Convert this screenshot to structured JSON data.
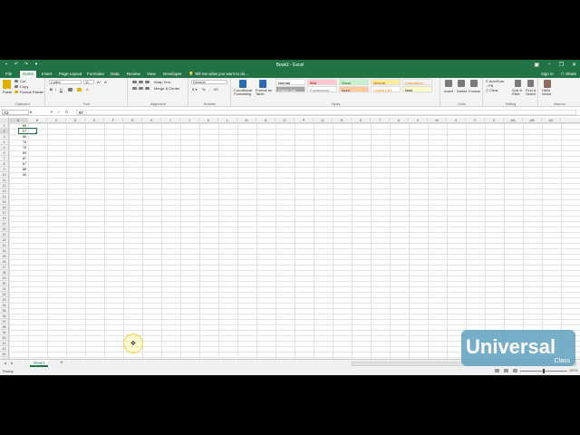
{
  "titlebar": {
    "title": "Book2 - Excel",
    "min": "−",
    "restore": "❐",
    "close": "✕"
  },
  "tabs": [
    {
      "label": "File"
    },
    {
      "label": "Home"
    },
    {
      "label": "Insert"
    },
    {
      "label": "Page Layout"
    },
    {
      "label": "Formulas"
    },
    {
      "label": "Data"
    },
    {
      "label": "Review"
    },
    {
      "label": "View"
    },
    {
      "label": "Developer"
    }
  ],
  "tell_me": "Tell me what you want to do...",
  "signin": "Sign in",
  "share": "Share",
  "ribbon": {
    "clipboard": {
      "paste": "Paste",
      "cut": "Cut",
      "copy": "Copy",
      "format_painter": "Format Painter",
      "label": "Clipboard"
    },
    "font": {
      "name": "Calibri",
      "size": "11",
      "label": "Font"
    },
    "alignment": {
      "wrap": "Wrap Text",
      "merge": "Merge & Center",
      "label": "Alignment"
    },
    "number": {
      "format": "General",
      "label": "Number"
    },
    "styles": {
      "conditional": "Conditional Formatting",
      "format_table": "Format as Table",
      "cells": [
        {
          "label": "Normal",
          "bg": "#ffffff",
          "fg": "#000000"
        },
        {
          "label": "Bad",
          "bg": "#ffc7ce",
          "fg": "#9c0006"
        },
        {
          "label": "Good",
          "bg": "#c6efce",
          "fg": "#006100"
        },
        {
          "label": "Neutral",
          "bg": "#ffeb9c",
          "fg": "#9c5700"
        },
        {
          "label": "Calculation",
          "bg": "#f2f2f2",
          "fg": "#fa7d00"
        },
        {
          "label": "Check Cell",
          "bg": "#a5a5a5",
          "fg": "#ffffff"
        },
        {
          "label": "Explanatory...",
          "bg": "#ffffff",
          "fg": "#7f7f7f"
        },
        {
          "label": "Input",
          "bg": "#ffcc99",
          "fg": "#3f3f76"
        },
        {
          "label": "Linked Cell",
          "bg": "#ffffff",
          "fg": "#fa7d00"
        },
        {
          "label": "Note",
          "bg": "#ffffcc",
          "fg": "#000000"
        }
      ],
      "label": "Styles"
    },
    "cells": {
      "insert": "Insert",
      "delete": "Delete",
      "format": "Format",
      "label": "Cells"
    },
    "editing": {
      "autosum": "AutoSum",
      "fill": "Fill",
      "clear": "Clear",
      "sort": "Sort & Filter",
      "find": "Find & Select",
      "label": "Editing"
    },
    "user": {
      "name": "Hello World",
      "label": "Macros"
    }
  },
  "formula_bar": {
    "name_box": "A2",
    "fx": "fx",
    "value": "97"
  },
  "columns": [
    "A",
    "B",
    "C",
    "D",
    "E",
    "F",
    "G",
    "H",
    "I",
    "J",
    "K",
    "L",
    "M",
    "N",
    "O",
    "P",
    "Q",
    "R",
    "S",
    "T",
    "U",
    "V",
    "W",
    "X",
    "Y",
    "Z",
    "AA",
    "AB",
    "AC"
  ],
  "rows": [
    "1",
    "2",
    "3",
    "4",
    "5",
    "6",
    "7",
    "8",
    "9",
    "10",
    "11",
    "12",
    "13",
    "14",
    "15",
    "16",
    "17",
    "18",
    "19",
    "20",
    "21",
    "22",
    "23",
    "24",
    "25",
    "26",
    "27",
    "28",
    "29",
    "30",
    "31",
    "32",
    "33",
    "34",
    "35",
    "36",
    "37",
    "38",
    "39",
    "40",
    "41",
    "42",
    "43",
    "44",
    "45",
    "46",
    "47",
    "48",
    "49",
    "50",
    "51",
    "52",
    "53",
    "54"
  ],
  "data": [
    "86",
    "97",
    "85",
    "76",
    "78",
    "89",
    "87",
    "67",
    "88",
    "40"
  ],
  "sheet_tab": "Sheet1",
  "add_sheet": "+",
  "status": {
    "ready": "Ready",
    "zoom": "100%"
  },
  "logo": {
    "main": "Universal",
    "sub": "Class"
  }
}
